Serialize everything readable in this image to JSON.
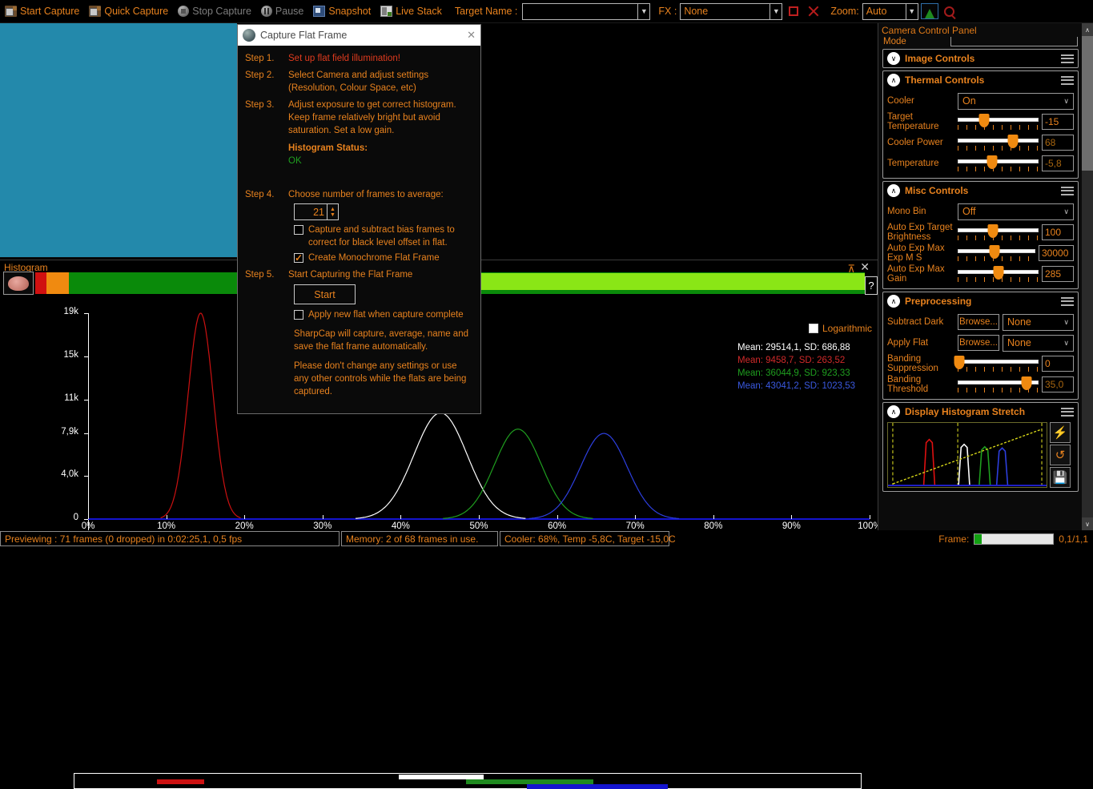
{
  "toolbar": {
    "start_capture": "Start Capture",
    "quick_capture": "Quick Capture",
    "stop_capture": "Stop Capture",
    "pause": "Pause",
    "snapshot": "Snapshot",
    "live_stack": "Live Stack",
    "target_name_label": "Target Name :",
    "target_name_value": "",
    "fx_label": "FX :",
    "fx_value": "None",
    "zoom_label": "Zoom:",
    "zoom_value": "Auto"
  },
  "dialog": {
    "title": "Capture Flat Frame",
    "close": "✕",
    "steps": {
      "s1_num": "Step 1.",
      "s1_text": "Set up flat field illumination!",
      "s2_num": "Step 2.",
      "s2_text": "Select Camera and adjust settings (Resolution, Colour Space, etc)",
      "s3_num": "Step 3.",
      "s3_text": "Adjust exposure to get correct histogram. Keep frame relatively bright but avoid saturation. Set a low gain.",
      "hist_status_label": "Histogram Status:",
      "hist_status_value": "OK",
      "s4_num": "Step 4.",
      "s4_text": "Choose number of frames to average:",
      "frames_value": "21",
      "bias_checkbox": "Capture and subtract bias frames to correct for black level offset in flat.",
      "bias_checked": false,
      "mono_checkbox": "Create Monochrome Flat Frame",
      "mono_checked": true,
      "s5_num": "Step 5.",
      "s5_text": "Start Capturing the Flat Frame",
      "start_button": "Start",
      "apply_checkbox": "Apply new flat when capture complete",
      "apply_checked": false,
      "note1": "SharpCap will capture, average, name and save the flat frame automatically.",
      "note2": "Please don't change any settings or use any other controls while the flats are being captured."
    }
  },
  "histogram_panel": {
    "title": "Histogram",
    "pin": "⊼",
    "close": "✕",
    "help": "?",
    "logarithmic_label": "Logarithmic",
    "logarithmic_checked": false,
    "stats": [
      {
        "text": "Mean: 29514,1, SD: 686,88",
        "colour": "#ffffff"
      },
      {
        "text": "Mean: 9458,7, SD: 263,52",
        "colour": "#d02a2a"
      },
      {
        "text": "Mean: 36044,9, SD: 923,33",
        "colour": "#1f9e1f"
      },
      {
        "text": "Mean: 43041,2, SD: 1023,53",
        "colour": "#3a59e0"
      }
    ]
  },
  "chart_data": {
    "type": "line",
    "title": "Histogram",
    "xlabel": "",
    "ylabel": "",
    "xlim": [
      0,
      100
    ],
    "ylim": [
      0,
      19000
    ],
    "xticks": [
      "0%",
      "10%",
      "20%",
      "30%",
      "40%",
      "50%",
      "60%",
      "70%",
      "80%",
      "90%",
      "100%"
    ],
    "xtick_values": [
      0,
      10,
      20,
      30,
      40,
      50,
      60,
      70,
      80,
      90,
      100
    ],
    "yticks": [
      "0",
      "4,0k",
      "7,9k",
      "11k",
      "15k",
      "19k"
    ],
    "ytick_values": [
      0,
      4000,
      7900,
      11000,
      15000,
      19000
    ],
    "grid": false,
    "legend": "none",
    "series": [
      {
        "name": "red",
        "colour": "#cc1111",
        "peak_x": 14.4,
        "peak_y": 19000,
        "width": 1.6
      },
      {
        "name": "white",
        "colour": "#ffffff",
        "peak_x": 45.1,
        "peak_y": 9800,
        "width": 3.4
      },
      {
        "name": "green",
        "colour": "#1f9e1f",
        "peak_x": 55.0,
        "peak_y": 8300,
        "width": 3.0
      },
      {
        "name": "blue",
        "colour": "#2d3fe0",
        "peak_x": 66.0,
        "peak_y": 7900,
        "width": 3.0
      }
    ],
    "range_bars": [
      {
        "name": "red",
        "colour": "#cc1111",
        "start": 10.5,
        "end": 16.5,
        "row": 1
      },
      {
        "name": "white",
        "colour": "#ffffff",
        "start": 41.2,
        "end": 52.0,
        "row": 0
      },
      {
        "name": "green",
        "colour": "#1f8a1f",
        "start": 49.8,
        "end": 66.0,
        "row": 1
      },
      {
        "name": "blue",
        "colour": "#1414cf",
        "start": 57.5,
        "end": 75.5,
        "row": 2
      }
    ]
  },
  "camera_panel": {
    "header": "Camera Control Panel",
    "pin": "⊼",
    "mode_label": "Mode",
    "groups": [
      {
        "name": "image",
        "title": "Image Controls",
        "collapsed": true
      },
      {
        "name": "thermal",
        "title": "Thermal Controls",
        "collapsed": false
      },
      {
        "name": "misc",
        "title": "Misc Controls",
        "collapsed": false
      },
      {
        "name": "preprocessing",
        "title": "Preprocessing",
        "collapsed": false
      },
      {
        "name": "stretch",
        "title": "Display Histogram Stretch",
        "collapsed": false
      }
    ],
    "thermal": {
      "cooler_label": "Cooler",
      "cooler_value": "On",
      "target_temperature_label": "Target Temperature",
      "target_temperature_value": "-15",
      "target_temperature_pct": 33,
      "cooler_power_label": "Cooler Power",
      "cooler_power_value": "68",
      "cooler_power_pct": 68,
      "temperature_label": "Temperature",
      "temperature_value": "-5,8",
      "temperature_pct": 43
    },
    "misc": {
      "mono_bin_label": "Mono Bin",
      "mono_bin_value": "Off",
      "auto_exp_target_brightness_label": "Auto Exp Target Brightness",
      "auto_exp_target_brightness_value": "100",
      "auto_exp_target_brightness_pct": 44,
      "auto_exp_max_exp_label": "Auto Exp Max Exp M S",
      "auto_exp_max_exp_value": "30000",
      "auto_exp_max_exp_pct": 47,
      "auto_exp_max_gain_label": "Auto Exp Max Gain",
      "auto_exp_max_gain_value": "285",
      "auto_exp_max_gain_pct": 50
    },
    "preprocessing": {
      "subtract_dark_label": "Subtract Dark",
      "subtract_dark_browse": "Browse...",
      "subtract_dark_value": "None",
      "apply_flat_label": "Apply Flat",
      "apply_flat_browse": "Browse...",
      "apply_flat_value": "None",
      "banding_suppression_label": "Banding Suppression",
      "banding_suppression_value": "0",
      "banding_suppression_pct": 2,
      "banding_threshold_label": "Banding Threshold",
      "banding_threshold_value": "35,0",
      "banding_threshold_pct": 85
    },
    "stretch": {
      "auto_button": "⚡",
      "reset_button": "↺",
      "save_button": "💾",
      "peaks": [
        {
          "colour": "#e01010",
          "x": 26,
          "h": 78
        },
        {
          "colour": "#ffffff",
          "x": 48,
          "h": 70
        },
        {
          "colour": "#1f9e1f",
          "x": 61,
          "h": 66
        },
        {
          "colour": "#2d3fe0",
          "x": 72,
          "h": 64
        }
      ],
      "markers": [
        3,
        44,
        97
      ]
    }
  },
  "statusbar": {
    "preview": "Previewing : 71 frames (0 dropped) in 0:02:25,1, 0,5 fps",
    "memory": "Memory: 2 of 68 frames in use.",
    "cooler": "Cooler: 68%, Temp -5,8C, Target -15,0C",
    "frame_label": "Frame:",
    "frame_value": "0,1/1,1",
    "frame_progress_pct": 9
  }
}
